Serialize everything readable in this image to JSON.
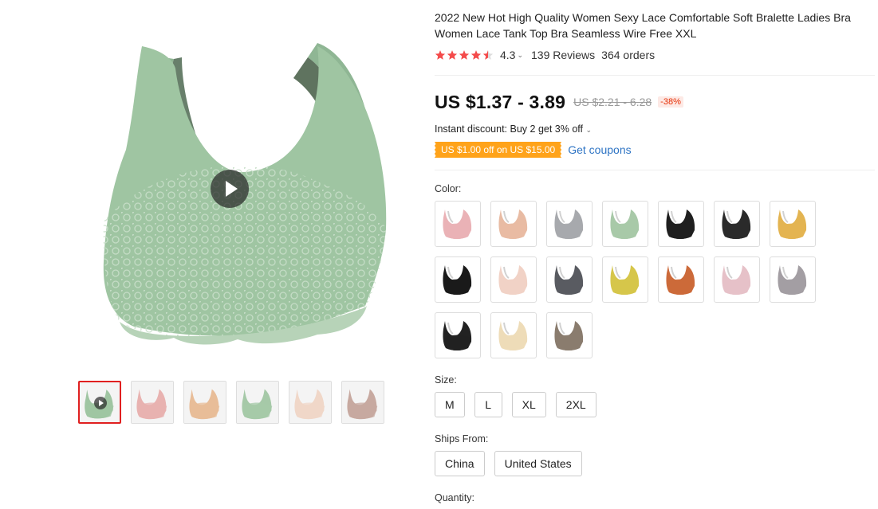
{
  "product": {
    "title": "2022 New Hot High Quality Women Sexy Lace Comfortable Soft Bralette Ladies Bra Women Lace Tank Top Bra Seamless Wire Free XXL",
    "rating": "4.3",
    "rating_value": 4.5,
    "reviews": "139 Reviews",
    "orders": "364 orders",
    "price": "US $1.37 - 3.89",
    "original_price": "US $2.21 - 6.28",
    "discount": "-38%",
    "instant_discount": "Instant discount: Buy 2 get 3% off",
    "coupon": "US $1.00 off on US $15.00",
    "get_coupons": "Get coupons"
  },
  "colors": {
    "accent": "#e02020",
    "star": "#f44b4b",
    "coupon_bg": "#ffa31a",
    "link": "#2e74c4"
  },
  "gallery": {
    "main_color": "#9fc5a2",
    "thumbnails": [
      {
        "name": "thumb-green-video",
        "color": "#9fc5a2",
        "video": true
      },
      {
        "name": "thumb-pink",
        "color": "#e8b2b0",
        "video": false
      },
      {
        "name": "thumb-nude",
        "color": "#e8bd98",
        "video": false
      },
      {
        "name": "thumb-green",
        "color": "#a6c9a8",
        "video": false
      },
      {
        "name": "thumb-folded",
        "color": "#f0d7c8",
        "video": false
      },
      {
        "name": "thumb-model",
        "color": "#c7a9a0",
        "video": false
      }
    ]
  },
  "options": {
    "color_label": "Color:",
    "swatches": [
      {
        "color": "#eab2b6"
      },
      {
        "color": "#e8bba3"
      },
      {
        "color": "#a7a9ad"
      },
      {
        "color": "#a8c9a8"
      },
      {
        "color": "#1f1f1f"
      },
      {
        "color": "#2a2a2a"
      },
      {
        "color": "#e3b451"
      },
      {
        "color": "#1a1a1a"
      },
      {
        "color": "#f1d2c6"
      },
      {
        "color": "#595b61"
      },
      {
        "color": "#d6c64a"
      },
      {
        "color": "#cc6a3a"
      },
      {
        "color": "#e6c1c8"
      },
      {
        "color": "#a39ea3"
      },
      {
        "color": "#222222"
      },
      {
        "color": "#eedcb8"
      },
      {
        "color": "#8a7c6e"
      }
    ],
    "size_label": "Size:",
    "sizes": [
      "M",
      "L",
      "XL",
      "2XL"
    ],
    "ships_label": "Ships From:",
    "ships_from": [
      "China",
      "United States"
    ],
    "quantity_label": "Quantity:"
  }
}
